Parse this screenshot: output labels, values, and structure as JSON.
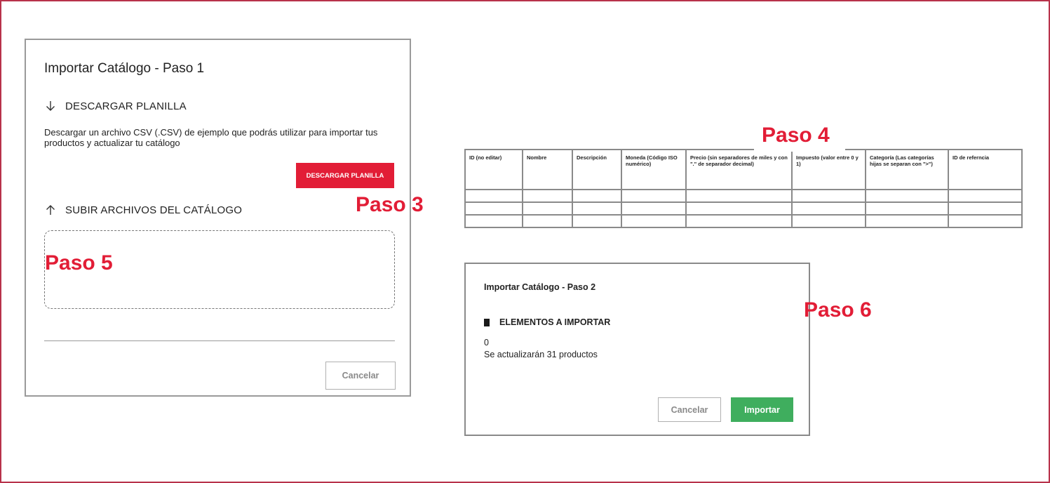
{
  "step1": {
    "title": "Importar Catálogo - Paso 1",
    "download_section": {
      "icon": "arrow-down-icon",
      "label": "DESCARGAR PLANILLA"
    },
    "description": "Descargar un archivo CSV (.CSV) de ejemplo que podrás utilizar para importar tus productos y actualizar tu catálogo",
    "download_button": "DESCARGAR PLANILLA",
    "upload_section": {
      "icon": "arrow-up-icon",
      "label": "SUBIR ARCHIVOS DEL CATÁLOGO"
    },
    "cancel_button": "Cancelar"
  },
  "steps": {
    "paso3": "Paso 3",
    "paso4": "Paso 4",
    "paso5": "Paso 5",
    "paso6": "Paso 6"
  },
  "csv_table": {
    "headers": [
      "ID (no editar)",
      "Nombre",
      "Descripción",
      "Moneda (Código ISO numérico)",
      "Precio (sin separadores de miles y con \".\" de separador decimal)",
      "Impuesto (valor entre 0 y 1)",
      "Categoría (Las categorías hijas se separan con \">\")",
      "ID de referncia"
    ],
    "empty_rows": 3
  },
  "step2": {
    "title": "Importar Catálogo - Paso 2",
    "section_label": "ELEMENTOS A IMPORTAR",
    "count": "0",
    "update_text": "Se actualizarán 31 productos",
    "cancel_button": "Cancelar",
    "import_button": "Importar"
  },
  "colors": {
    "accent_red": "#e21d36",
    "frame_border": "#b8324a",
    "import_green": "#3fae5e"
  }
}
